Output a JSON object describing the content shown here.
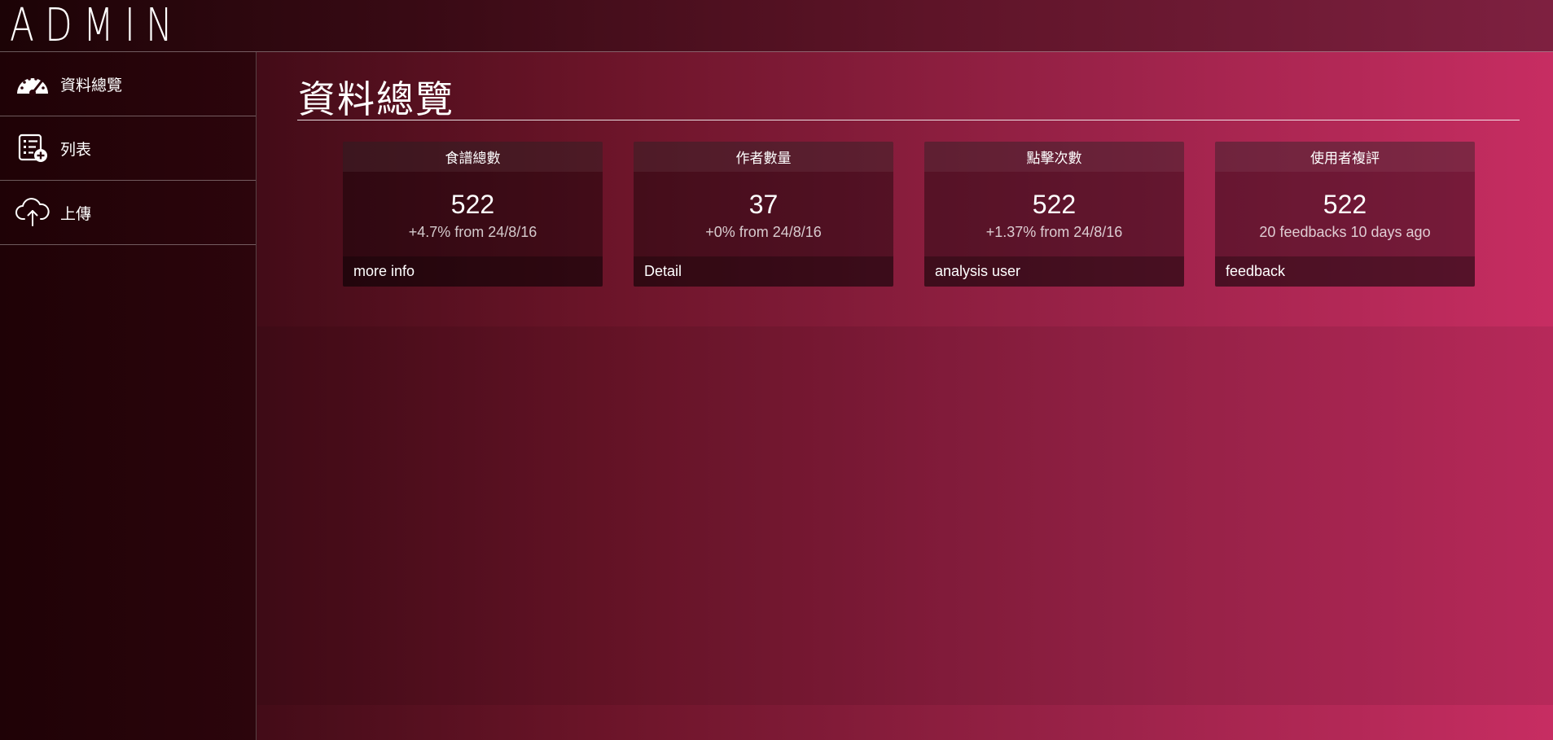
{
  "app": {
    "brand": "ADMIN"
  },
  "sidebar": {
    "items": [
      {
        "label": "資料總覽",
        "icon": "dashboard-gauge-icon"
      },
      {
        "label": "列表",
        "icon": "list-add-icon"
      },
      {
        "label": "上傳",
        "icon": "cloud-upload-icon"
      }
    ]
  },
  "main": {
    "title": "資料總覽",
    "cards": [
      {
        "header": "食譜總數",
        "value": "522",
        "sub": "+4.7% from 24/8/16",
        "footer": "more info"
      },
      {
        "header": "作者數量",
        "value": "37",
        "sub": "+0% from 24/8/16",
        "footer": "Detail"
      },
      {
        "header": "點擊次數",
        "value": "522",
        "sub": "+1.37% from 24/8/16",
        "footer": "analysis user"
      },
      {
        "header": "使用者複評",
        "value": "522",
        "sub": "20 feedbacks 10 days ago",
        "footer": "feedback"
      }
    ]
  },
  "colors": {
    "background_left": "#220307",
    "background_right": "#c72d62",
    "sidebar": "#24040a",
    "text": "#ffffff"
  }
}
